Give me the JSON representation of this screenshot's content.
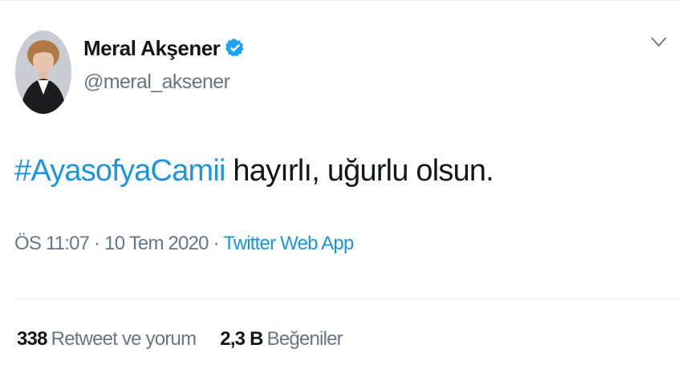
{
  "author": {
    "name": "Meral Akşener",
    "handle": "@meral_aksener",
    "verified": true,
    "verified_color": "#1da1f2"
  },
  "tweet": {
    "hashtag": "#AyasofyaCamii",
    "text": " hayırlı, uğurlu olsun.",
    "hashtag_color": "#1b95e0"
  },
  "meta": {
    "time": "ÖS 11:07",
    "separator1": " · ",
    "date": "10 Tem 2020",
    "separator2": " · ",
    "source": "Twitter Web App"
  },
  "stats": {
    "retweets_count": "338",
    "retweets_label": "Retweet ve yorum",
    "likes_count": "2,3 B",
    "likes_label": "Beğeniler"
  },
  "icons": {
    "menu": "chevron-down-icon",
    "verified": "verified-badge-icon"
  }
}
